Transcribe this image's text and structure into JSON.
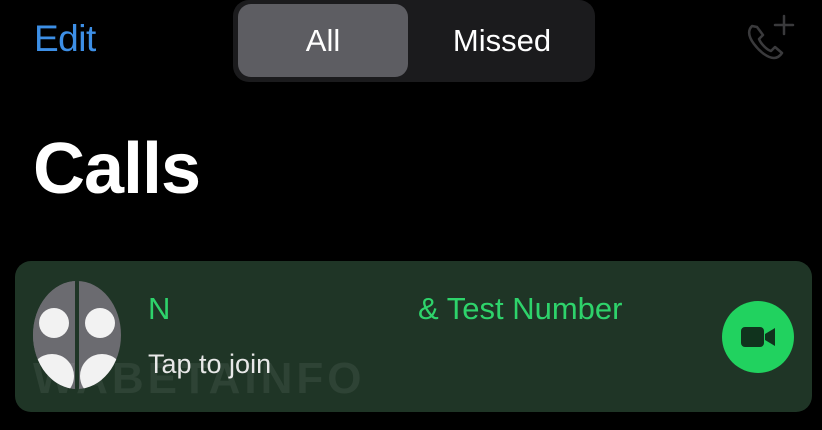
{
  "header": {
    "edit_label": "Edit",
    "tabs": [
      {
        "label": "All",
        "selected": true
      },
      {
        "label": "Missed",
        "selected": false
      }
    ],
    "new_call_icon": "phone-plus-icon"
  },
  "page_title": "Calls",
  "call_row": {
    "name_part1": "N",
    "name_part2": "& Test Number",
    "subtitle": "Tap to join",
    "avatar_icon": "group-avatar-icon",
    "action_icon": "video-camera-icon"
  },
  "watermark": "WABETAINFO",
  "colors": {
    "accent_blue": "#3d8fe6",
    "green": "#2ed36b",
    "row_bg": "#1f3526",
    "segment_selected": "#5d5d62"
  }
}
